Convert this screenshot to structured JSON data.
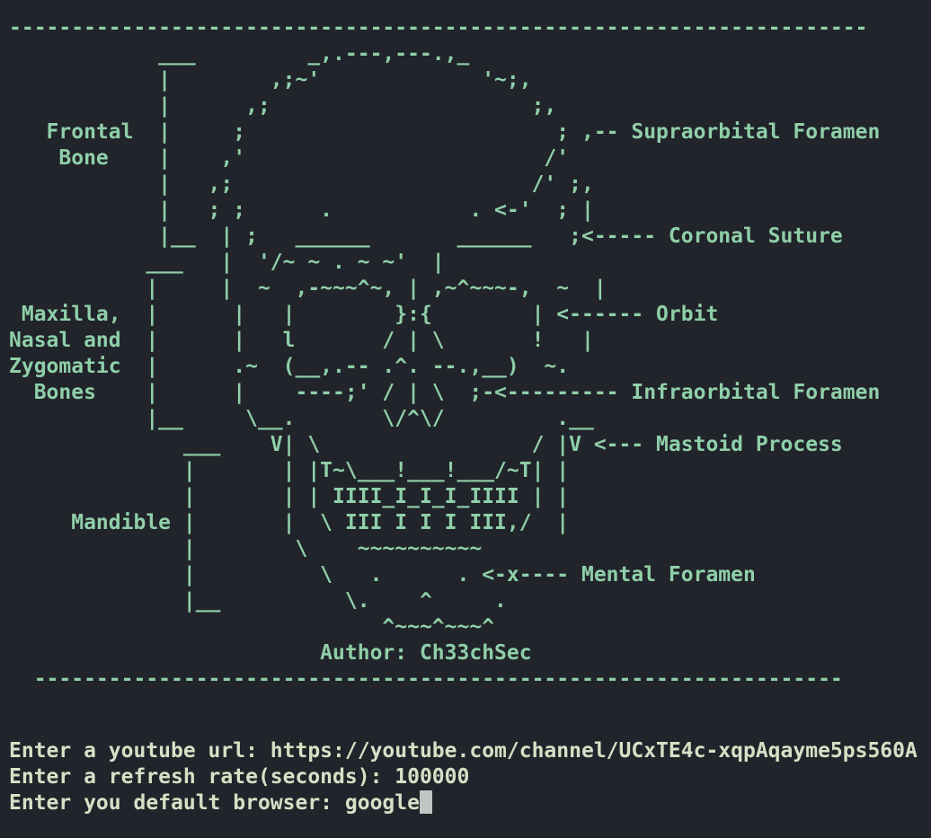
{
  "colors": {
    "background": "#21242a",
    "art": "#8fcfa9",
    "prompt_text": "#d7e0c6",
    "cursor": "#bfc5c2"
  },
  "banner": {
    "lines": [
      "---------------------------------------------------------------------",
      "            ___         _,.---,---.,_",
      "            |        ,;~'             '~;,",
      "            |      ,;                     ;,",
      "   Frontal  |     ;                         ; ,-- Supraorbital Foramen",
      "    Bone    |    ,'                        /'",
      "            |   ,;                        /' ;,",
      "            |   ; ;      .           . <-'  ; |",
      "            |__  | ;   ______       ______   ;<----- Coronal Suture",
      "           ___   |  '/~ ~ . ~ ~'  |",
      "           |     |  ~  ,-~~~^~, | ,~^~~~-,  ~  |",
      " Maxilla,  |      |   |        }:{        | <------ Orbit",
      "Nasal and  |      |   l       / | \\       !   |",
      "Zygomatic  |      .~  (__,.-- .^. --.,__)  ~.",
      "  Bones    |      |    ----;' / | \\  ;-<--------- Infraorbital Foramen",
      "           |__     \\__.       \\/^\\/         .__",
      "              ___    V| \\                 / |V <--- Mastoid Process",
      "              |       | |T~\\___!___!___/~T| |",
      "              |       | | IIII_I_I_I_IIII | |",
      "     Mandible |       |  \\ III I I I III,/  |",
      "              |        \\    ~~~~~~~~~~",
      "              |          \\   .      . <-x---- Mental Foramen",
      "              |__          \\.    ^     .",
      "                              ^~~~^~~~^",
      "                         Author: Ch33chSec",
      "  -----------------------------------------------------------------"
    ]
  },
  "prompts": {
    "youtube_url": "Enter a youtube url: https://youtube.com/channel/UCxTE4c-xqpAqayme5ps560A",
    "refresh_rate": "Enter a refresh rate(seconds): 100000",
    "default_browser": "Enter you default browser: google"
  }
}
